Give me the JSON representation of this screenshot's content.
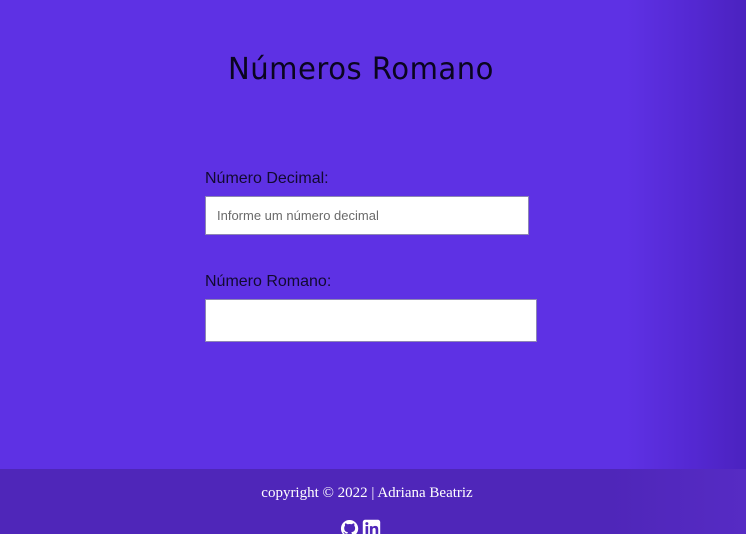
{
  "header": {
    "title": "Números Romano"
  },
  "form": {
    "decimal": {
      "label": "Número Decimal:",
      "value": "",
      "placeholder": "Informe um número decimal"
    },
    "roman": {
      "label": "Número Romano:",
      "value": ""
    }
  },
  "footer": {
    "copyright": "copyright © 2022 | Adriana Beatriz",
    "social": [
      {
        "icon": "github-icon"
      },
      {
        "icon": "linkedin-icon"
      }
    ]
  },
  "colors": {
    "background": "#5e31e4",
    "footer": "#4f26b9",
    "title": "#0a0520"
  }
}
